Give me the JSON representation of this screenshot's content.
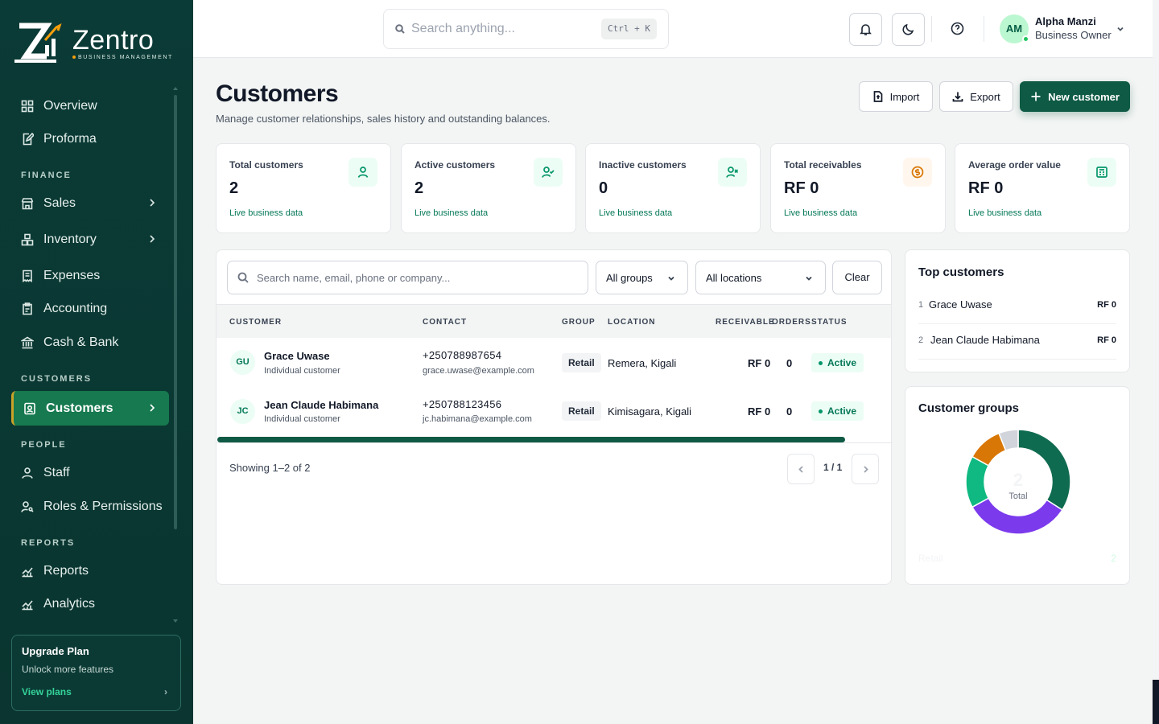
{
  "brand": {
    "name": "Zentro",
    "tagline": "BUSINESS MANAGEMENT"
  },
  "sidebar": {
    "items": [
      {
        "label": "Overview",
        "icon": "grid-icon"
      },
      {
        "label": "Proforma",
        "icon": "file-edit-icon"
      },
      {
        "label": "Sales",
        "icon": "store-icon"
      },
      {
        "label": "Inventory",
        "icon": "boxes-icon"
      },
      {
        "label": "Expenses",
        "icon": "receipt-icon"
      },
      {
        "label": "Accounting",
        "icon": "clipboard-icon"
      },
      {
        "label": "Cash & Bank",
        "icon": "bank-icon"
      },
      {
        "label": "Customers",
        "icon": "contact-icon",
        "active": true
      },
      {
        "label": "Staff",
        "icon": "user-icon"
      },
      {
        "label": "Roles & Permissions",
        "icon": "user-key-icon"
      },
      {
        "label": "Reports",
        "icon": "chart-line-icon"
      },
      {
        "label": "Analytics",
        "icon": "chart-line-icon"
      }
    ],
    "sections": {
      "finance": "FINANCE",
      "customers": "CUSTOMERS",
      "people": "PEOPLE",
      "reports": "REPORTS"
    },
    "upgrade": {
      "title": "Upgrade Plan",
      "subtitle": "Unlock more features",
      "link": "View plans"
    }
  },
  "topbar": {
    "search_placeholder": "Search anything...",
    "shortcut": "Ctrl + K",
    "user": {
      "initials": "AM",
      "name": "Alpha Manzi",
      "role": "Business Owner"
    }
  },
  "page": {
    "title": "Customers",
    "subtitle": "Manage customer relationships, sales history and outstanding balances.",
    "actions": {
      "import": "Import",
      "export": "Export",
      "new": "New customer"
    }
  },
  "stats": [
    {
      "label": "Total customers",
      "value": "2",
      "note": "Live business data",
      "icon": "user-icon"
    },
    {
      "label": "Active customers",
      "value": "2",
      "note": "Live business data",
      "icon": "user-check-icon"
    },
    {
      "label": "Inactive customers",
      "value": "0",
      "note": "Live business data",
      "icon": "user-x-icon"
    },
    {
      "label": "Total receivables",
      "value": "RF 0",
      "note": "Live business data",
      "icon": "coin-icon"
    },
    {
      "label": "Average order value",
      "value": "RF 0",
      "note": "Live business data",
      "icon": "register-icon"
    }
  ],
  "filters": {
    "search_placeholder": "Search name, email, phone or company...",
    "group": "All groups",
    "location": "All locations",
    "clear": "Clear"
  },
  "table": {
    "columns": [
      "CUSTOMER",
      "CONTACT",
      "GROUP",
      "LOCATION",
      "RECEIVABLE",
      "ORDERS",
      "STATUS"
    ],
    "rows": [
      {
        "initials": "GU",
        "name": "Grace Uwase",
        "type": "Individual customer",
        "phone": "+250788987654",
        "email": "grace.uwase@example.com",
        "group": "Retail",
        "location": "Remera, Kigali",
        "receivable": "RF 0",
        "orders": "0",
        "status": "Active"
      },
      {
        "initials": "JC",
        "name": "Jean Claude Habimana",
        "type": "Individual customer",
        "phone": "+250788123456",
        "email": "jc.habimana@example.com",
        "group": "Retail",
        "location": "Kimisagara, Kigali",
        "receivable": "RF 0",
        "orders": "0",
        "status": "Active"
      }
    ],
    "showing": "Showing 1–2 of 2",
    "page": "1 / 1"
  },
  "top_customers": {
    "title": "Top customers",
    "items": [
      {
        "rank": "1",
        "name": "Grace Uwase",
        "amount": "RF 0"
      },
      {
        "rank": "2",
        "name": "Jean Claude Habimana",
        "amount": "RF 0"
      }
    ]
  },
  "groups": {
    "title": "Customer groups",
    "total_value": "2",
    "total_label": "Total",
    "legend": {
      "name": "Retail",
      "value": "2"
    },
    "segments": [
      {
        "color": "#0f6b4f",
        "fraction": 0.34
      },
      {
        "color": "#7c3aed",
        "fraction": 0.33
      },
      {
        "color": "#10b981",
        "fraction": 0.16
      },
      {
        "color": "#d97706",
        "fraction": 0.11
      },
      {
        "color": "#d1d5db",
        "fraction": 0.06
      }
    ]
  }
}
